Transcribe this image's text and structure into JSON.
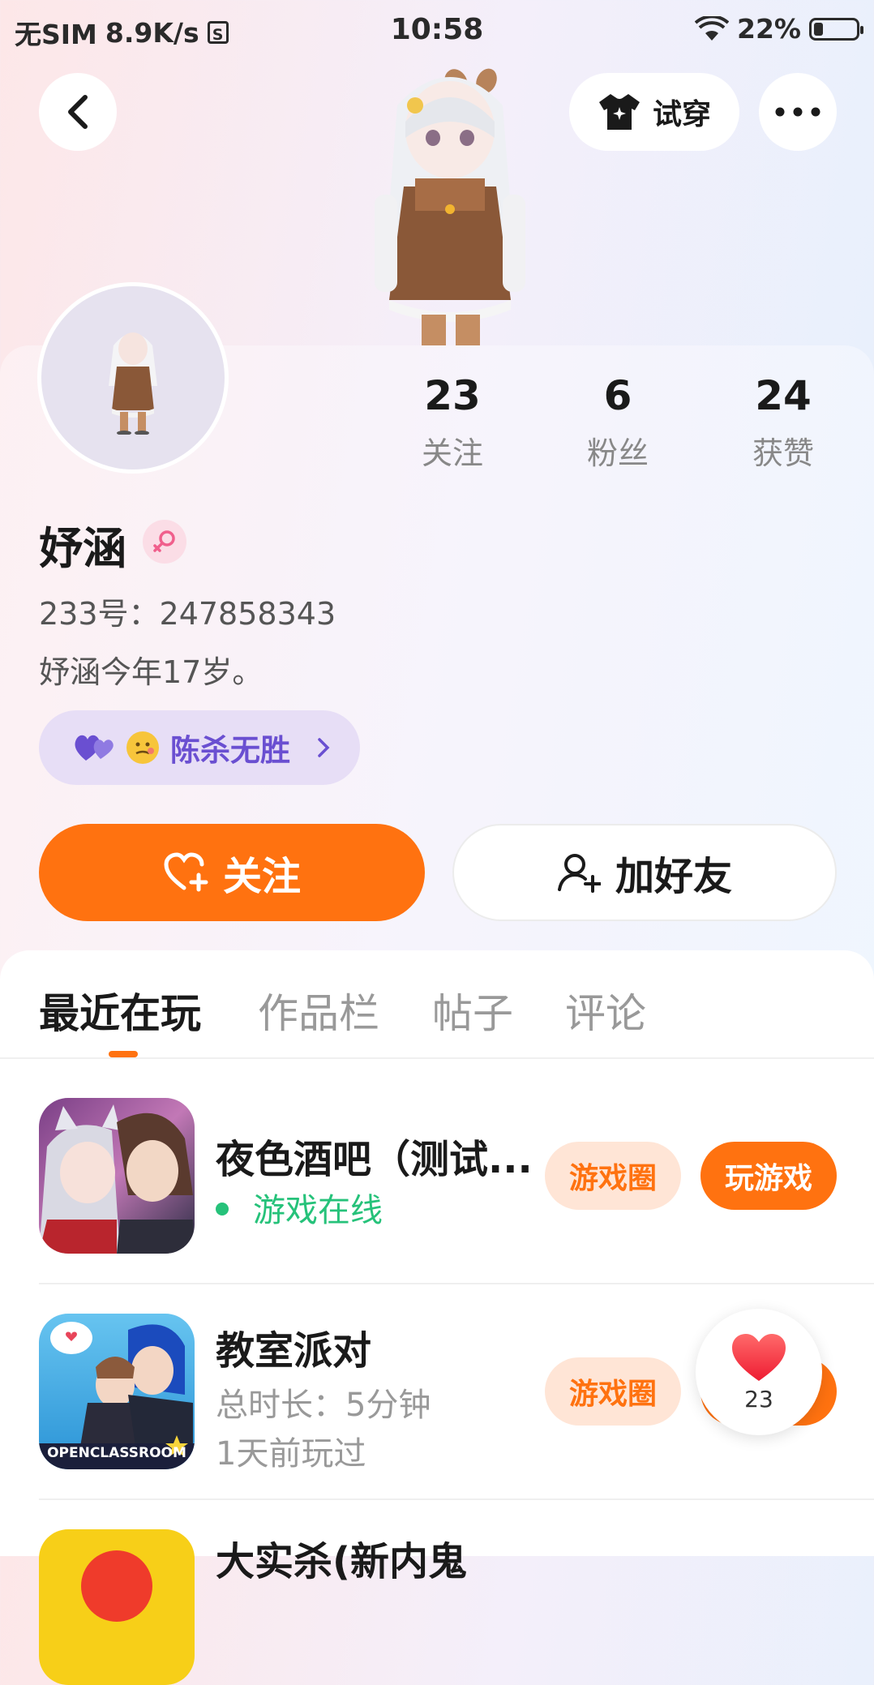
{
  "status_bar": {
    "carrier": "无SIM",
    "speed": "8.9K/s",
    "sd_badge": "S",
    "time": "10:58",
    "battery_text": "22%",
    "battery_level": 0.22
  },
  "header": {
    "back_icon": "chevron-left-icon",
    "tryon_label": "试穿",
    "more_icon": "more-icon"
  },
  "stats": [
    {
      "value": "23",
      "label": "关注"
    },
    {
      "value": "6",
      "label": "粉丝"
    },
    {
      "value": "24",
      "label": "获赞"
    }
  ],
  "profile": {
    "name": "妤涵",
    "gender": "female",
    "uid": "233号：247858343",
    "bio": "妤涵今年17岁。"
  },
  "relation_tag": {
    "label": "陈杀无胜"
  },
  "actions": {
    "follow_label": "关注",
    "add_friend_label": "加好友"
  },
  "tabs": [
    {
      "label": "最近在玩",
      "active": true
    },
    {
      "label": "作品栏",
      "active": false
    },
    {
      "label": "帖子",
      "active": false
    },
    {
      "label": "评论",
      "active": false
    }
  ],
  "games": [
    {
      "title": "夜色酒吧（测试...",
      "status": "游戏在线",
      "circle_label": "游戏圈",
      "play_label": "玩游戏"
    },
    {
      "title": "教室派对",
      "duration": "总时长：5分钟",
      "last_played": "1天前玩过",
      "circle_label": "游戏圈",
      "icon_text": "OPENCLASSROOM"
    },
    {
      "title": "大实杀(新内鬼"
    }
  ],
  "like_float": {
    "count": "23"
  },
  "colors": {
    "accent": "#ff7210",
    "online": "#26c27a",
    "relation_purple": "#6a4fd1"
  }
}
